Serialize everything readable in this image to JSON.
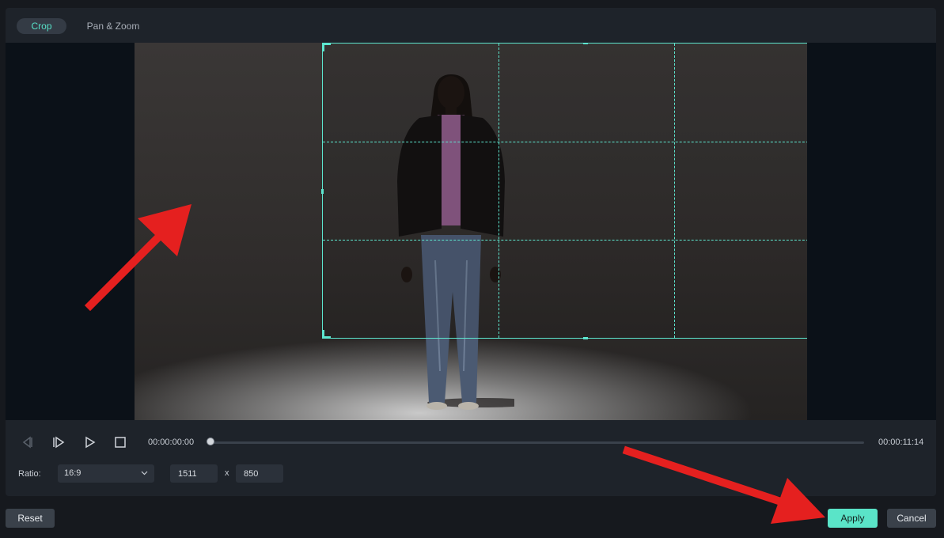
{
  "tabs": [
    {
      "label": "Crop",
      "active": true
    },
    {
      "label": "Pan & Zoom",
      "active": false
    }
  ],
  "playback": {
    "current_time": "00:00:00:00",
    "end_time": "00:00:11:14",
    "progress": 0
  },
  "ratio": {
    "label": "Ratio:",
    "value": "16:9"
  },
  "dimensions": {
    "width": "1511",
    "separator": "x",
    "height": "850"
  },
  "buttons": {
    "reset": "Reset",
    "apply": "Apply",
    "cancel": "Cancel"
  },
  "icons": {
    "prev_frame": "step-back-icon",
    "next_frame": "step-forward-icon",
    "play": "play-icon",
    "stop": "stop-icon",
    "chevron": "chevron-down-icon"
  },
  "colors": {
    "accent": "#5ae4c8",
    "annotation_arrow": "#e5201f"
  }
}
